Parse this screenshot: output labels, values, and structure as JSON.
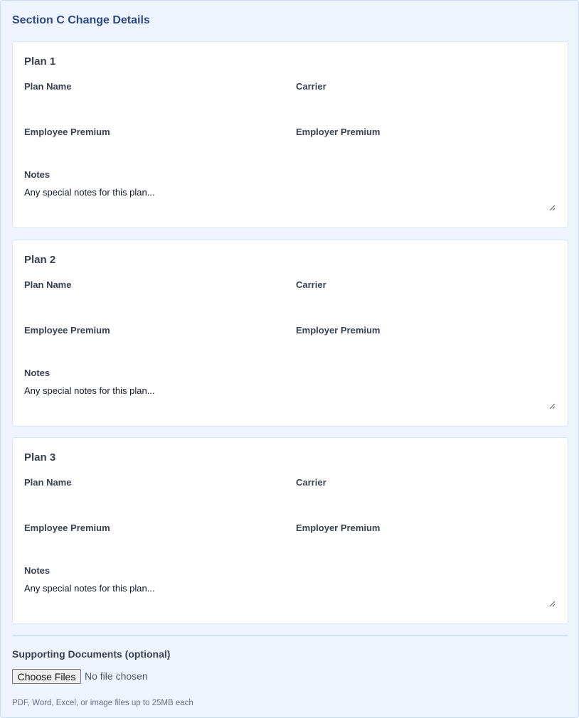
{
  "section": {
    "title": "Section C Change Details"
  },
  "plans": [
    {
      "title": "Plan 1",
      "plan_name_label": "Plan Name",
      "carrier_label": "Carrier",
      "employee_premium_label": "Employee Premium",
      "employer_premium_label": "Employer Premium",
      "notes_label": "Notes",
      "notes_placeholder": "Any special notes for this plan..."
    },
    {
      "title": "Plan 2",
      "plan_name_label": "Plan Name",
      "carrier_label": "Carrier",
      "employee_premium_label": "Employee Premium",
      "employer_premium_label": "Employer Premium",
      "notes_label": "Notes",
      "notes_placeholder": "Any special notes for this plan..."
    },
    {
      "title": "Plan 3",
      "plan_name_label": "Plan Name",
      "carrier_label": "Carrier",
      "employee_premium_label": "Employee Premium",
      "employer_premium_label": "Employer Premium",
      "notes_label": "Notes",
      "notes_placeholder": "Any special notes for this plan..."
    }
  ],
  "supporting_documents": {
    "label": "Supporting Documents (optional)",
    "button_label": "Choose Files",
    "status": "No file chosen",
    "help_text": "PDF, Word, Excel, or image files up to 25MB each"
  },
  "colors": {
    "section_bg": "#eef4fe",
    "section_title": "#2e4a86",
    "card_bg": "#ffffff",
    "label_text": "#374151"
  }
}
